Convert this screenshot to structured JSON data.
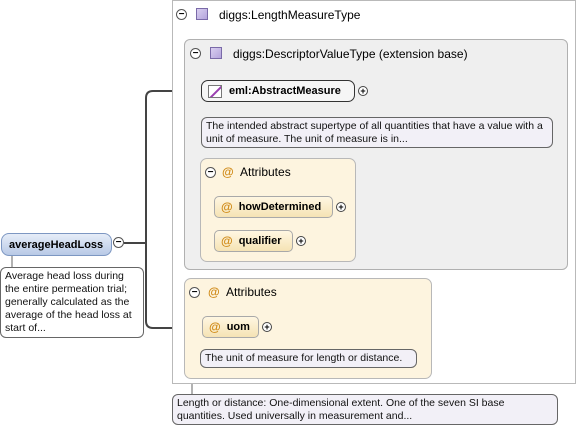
{
  "root_element": {
    "name": "averageHeadLoss",
    "doc": "Average head loss during the entire permeation trial; generally calculated as the average of the head loss at start of..."
  },
  "length_measure_type": {
    "name": "diggs:LengthMeasureType",
    "doc": "Length or distance: One-dimensional extent. One of the seven SI base quantities. Used universally in measurement and..."
  },
  "descriptor_value_type": {
    "name": "diggs:DescriptorValueType (extension base)"
  },
  "abstract_measure": {
    "name": "eml:AbstractMeasure",
    "doc": "The intended abstract supertype of all quantities that have a value with a unit of measure. The unit of measure is in..."
  },
  "inner_attributes": {
    "heading": "Attributes",
    "items": [
      "howDetermined",
      "qualifier"
    ]
  },
  "outer_attributes": {
    "heading": "Attributes",
    "uom": {
      "name": "uom",
      "doc": "The unit of measure for length or distance."
    }
  },
  "symbols": {
    "at": "@",
    "minus": "−",
    "plus": "+"
  },
  "colors": {
    "attribute_bg": "#fdf4df",
    "type_icon": "#b4a4dc",
    "root_element": "#b8c9e6"
  }
}
